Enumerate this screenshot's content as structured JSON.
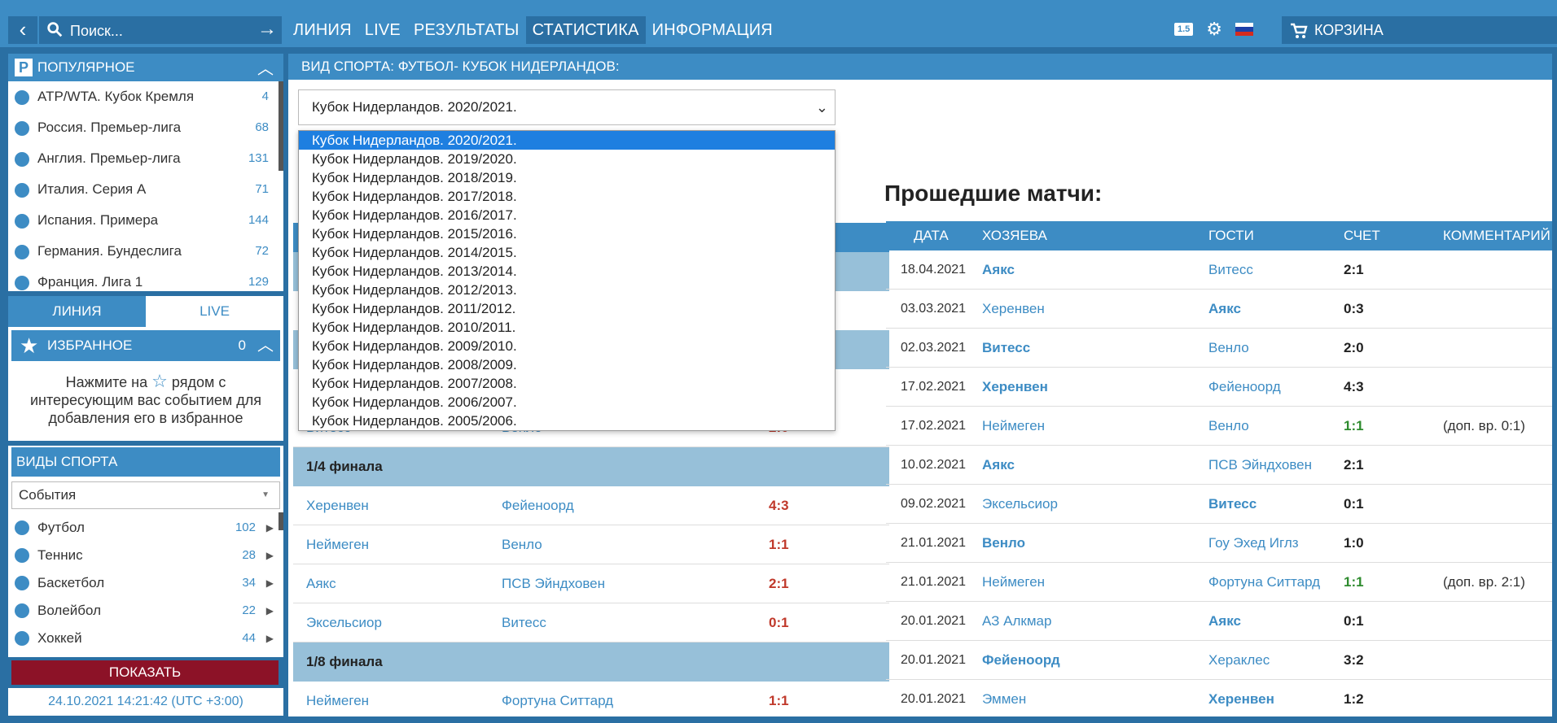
{
  "topbar": {
    "search_placeholder": "Поиск...",
    "nav": [
      "ЛИНИЯ",
      "LIVE",
      "РЕЗУЛЬТАТЫ",
      "СТАТИСТИКА",
      "ИНФОРМАЦИЯ"
    ],
    "active_nav": "СТАТИСТИКА",
    "odds_badge": "1.5",
    "cart_label": "КОРЗИНА"
  },
  "popular": {
    "title": "ПОПУЛЯРНОЕ",
    "items": [
      {
        "label": "ATP/WTA. Кубок Кремля",
        "count": "4"
      },
      {
        "label": "Россия. Премьер-лига",
        "count": "68"
      },
      {
        "label": "Англия. Премьер-лига",
        "count": "131"
      },
      {
        "label": "Италия. Серия А",
        "count": "71"
      },
      {
        "label": "Испания. Примера",
        "count": "144"
      },
      {
        "label": "Германия. Бундеслига",
        "count": "72"
      },
      {
        "label": "Франция. Лига 1",
        "count": "129"
      }
    ]
  },
  "mode_tabs": {
    "line": "ЛИНИЯ",
    "live": "LIVE"
  },
  "favorites": {
    "title": "ИЗБРАННОЕ",
    "count": "0",
    "hint_before": "Нажмите на",
    "hint_after": "рядом с интересующим вас событием для добавления его в избранное"
  },
  "sports": {
    "title": "ВИДЫ СПОРТА",
    "select_value": "События",
    "items": [
      {
        "label": "Футбол",
        "count": "102"
      },
      {
        "label": "Теннис",
        "count": "28"
      },
      {
        "label": "Баскетбол",
        "count": "34"
      },
      {
        "label": "Волейбол",
        "count": "22"
      },
      {
        "label": "Хоккей",
        "count": "44"
      }
    ]
  },
  "show_button": "ПОКАЗАТЬ",
  "clock": "24.10.2021 14:21:42 (UTC +3:00)",
  "main": {
    "header": "ВИД СПОРТА: ФУТБОЛ- КУБОК НИДЕРЛАНДОВ:",
    "season_selected": "Кубок Нидерландов. 2020/2021.",
    "season_options": [
      "Кубок Нидерландов. 2020/2021.",
      "Кубок Нидерландов. 2019/2020.",
      "Кубок Нидерландов. 2018/2019.",
      "Кубок Нидерландов. 2017/2018.",
      "Кубок Нидерландов. 2016/2017.",
      "Кубок Нидерландов. 2015/2016.",
      "Кубок Нидерландов. 2014/2015.",
      "Кубок Нидерландов. 2013/2014.",
      "Кубок Нидерландов. 2012/2013.",
      "Кубок Нидерландов. 2011/2012.",
      "Кубок Нидерландов. 2010/2011.",
      "Кубок Нидерландов. 2009/2010.",
      "Кубок Нидерландов. 2008/2009.",
      "Кубок Нидерландов. 2007/2008.",
      "Кубок Нидерландов. 2006/2007.",
      "Кубок Нидерландов. 2005/2006."
    ],
    "bracket": {
      "partial_row": {
        "home": "Витесс",
        "guest": "Венло",
        "score": "2:0"
      },
      "quarter": {
        "title": "1/4 финала",
        "matches": [
          {
            "home": "Херенвен",
            "guest": "Фейеноорд",
            "score": "4:3"
          },
          {
            "home": "Неймеген",
            "guest": "Венло",
            "score": "1:1"
          },
          {
            "home": "Аякс",
            "guest": "ПСВ Эйндховен",
            "score": "2:1"
          },
          {
            "home": "Эксельсиор",
            "guest": "Витесс",
            "score": "0:1"
          }
        ]
      },
      "eighth": {
        "title": "1/8 финала",
        "matches": [
          {
            "home": "Неймеген",
            "guest": "Фортуна Ситтард",
            "score": "1:1"
          }
        ]
      }
    },
    "past": {
      "title": "Прошедшие матчи:",
      "headers": {
        "date": "ДАТА",
        "home": "ХОЗЯЕВА",
        "guest": "ГОСТИ",
        "score": "СЧЕТ",
        "comment": "КОММЕНТАРИЙ"
      },
      "rows": [
        {
          "date": "18.04.2021",
          "home": "Аякс",
          "guest": "Витесс",
          "score": "2:1",
          "comment": ""
        },
        {
          "date": "03.03.2021",
          "home": "Херенвен",
          "guest": "Аякс",
          "score": "0:3",
          "comment": ""
        },
        {
          "date": "02.03.2021",
          "home": "Витесс",
          "guest": "Венло",
          "score": "2:0",
          "comment": ""
        },
        {
          "date": "17.02.2021",
          "home": "Херенвен",
          "guest": "Фейеноорд",
          "score": "4:3",
          "comment": ""
        },
        {
          "date": "17.02.2021",
          "home": "Неймеген",
          "guest": "Венло",
          "score": "1:1",
          "comment": "(доп. вр. 0:1)"
        },
        {
          "date": "10.02.2021",
          "home": "Аякс",
          "guest": "ПСВ Эйндховен",
          "score": "2:1",
          "comment": ""
        },
        {
          "date": "09.02.2021",
          "home": "Эксельсиор",
          "guest": "Витесс",
          "score": "0:1",
          "comment": ""
        },
        {
          "date": "21.01.2021",
          "home": "Венло",
          "guest": "Гоу Эхед Иглз",
          "score": "1:0",
          "comment": ""
        },
        {
          "date": "21.01.2021",
          "home": "Неймеген",
          "guest": "Фортуна Ситтард",
          "score": "1:1",
          "comment": "(доп. вр. 2:1)"
        },
        {
          "date": "20.01.2021",
          "home": "АЗ Алкмар",
          "guest": "Аякс",
          "score": "0:1",
          "comment": ""
        },
        {
          "date": "20.01.2021",
          "home": "Фейеноорд",
          "guest": "Хераклес",
          "score": "3:2",
          "comment": ""
        },
        {
          "date": "20.01.2021",
          "home": "Эммен",
          "guest": "Херенвен",
          "score": "1:2",
          "comment": ""
        }
      ]
    }
  },
  "colors": {
    "primary": "#3d8cc4",
    "dark": "#2a6fa3",
    "show_button": "#8c1227",
    "selected_option": "#1e7fe0"
  }
}
